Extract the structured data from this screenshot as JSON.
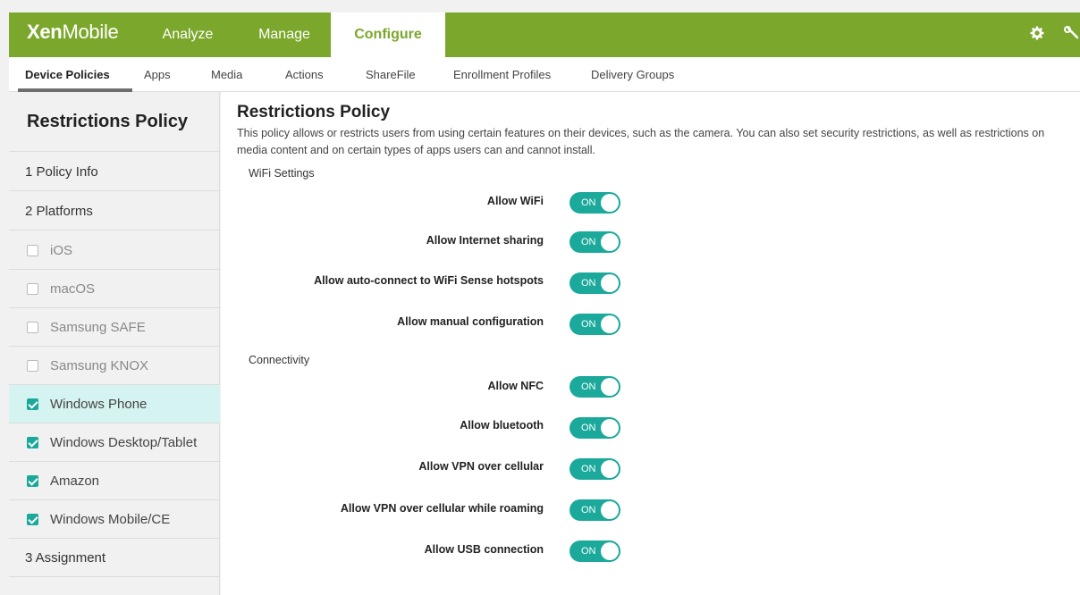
{
  "app": {
    "logo_bold": "Xen",
    "logo_light": "Mobile"
  },
  "topnav": {
    "tabs": [
      {
        "label": "Analyze"
      },
      {
        "label": "Manage"
      },
      {
        "label": "Configure"
      }
    ]
  },
  "top_icons": {
    "settings": "gear-icon",
    "tools": "wrench-icon"
  },
  "subnav": {
    "items": [
      {
        "label": "Device Policies"
      },
      {
        "label": "Apps"
      },
      {
        "label": "Media"
      },
      {
        "label": "Actions"
      },
      {
        "label": "ShareFile"
      },
      {
        "label": "Enrollment Profiles"
      },
      {
        "label": "Delivery Groups"
      }
    ]
  },
  "sidebar": {
    "title": "Restrictions Policy",
    "steps": [
      {
        "label": "1  Policy Info"
      },
      {
        "label": "2  Platforms"
      },
      {
        "label": "3  Assignment"
      }
    ],
    "platforms": [
      {
        "label": "iOS",
        "checked": false
      },
      {
        "label": "macOS",
        "checked": false
      },
      {
        "label": "Samsung SAFE",
        "checked": false
      },
      {
        "label": "Samsung KNOX",
        "checked": false
      },
      {
        "label": "Windows Phone",
        "checked": true
      },
      {
        "label": "Windows Desktop/Tablet",
        "checked": true
      },
      {
        "label": "Amazon",
        "checked": true
      },
      {
        "label": "Windows Mobile/CE",
        "checked": true
      }
    ]
  },
  "main": {
    "title": "Restrictions Policy",
    "description": "This policy allows or restricts users from using certain features on their devices, such as the camera. You can also set security restrictions, as well as restrictions on media content and on certain types of apps users can and cannot install.",
    "sections": [
      {
        "heading": "WiFi Settings",
        "settings": [
          {
            "label": "Allow WiFi",
            "state": "ON"
          },
          {
            "label": "Allow Internet sharing",
            "state": "ON"
          },
          {
            "label": "Allow auto-connect to WiFi Sense hotspots",
            "state": "ON"
          },
          {
            "label": "Allow manual configuration",
            "state": "ON"
          }
        ]
      },
      {
        "heading": "Connectivity",
        "settings": [
          {
            "label": "Allow NFC",
            "state": "ON"
          },
          {
            "label": "Allow bluetooth",
            "state": "ON"
          },
          {
            "label": "Allow VPN over cellular",
            "state": "ON"
          },
          {
            "label": "Allow VPN over cellular while roaming",
            "state": "ON"
          },
          {
            "label": "Allow USB connection",
            "state": "ON"
          }
        ]
      }
    ]
  },
  "colors": {
    "brand_green": "#7ba82c",
    "toggle_teal": "#1aa99b",
    "selected_row": "#d5f3f0"
  }
}
